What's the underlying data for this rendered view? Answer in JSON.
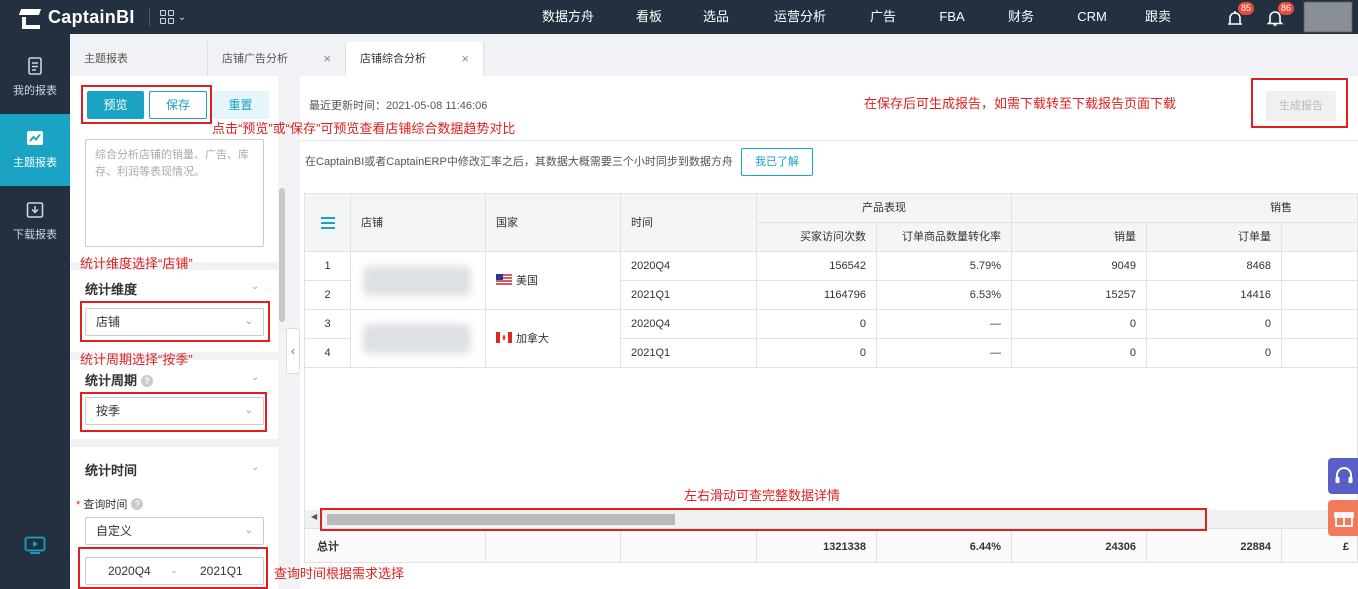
{
  "brand": {
    "name": "CaptainBI"
  },
  "nav": {
    "items": [
      "数据方舟",
      "看板",
      "选品",
      "运营分析",
      "广告",
      "FBA",
      "财务",
      "CRM",
      "跟卖"
    ],
    "notif1_badge": "85",
    "notif2_badge": "86"
  },
  "sidebar": {
    "items": [
      {
        "label": "我的报表",
        "icon": "report-icon"
      },
      {
        "label": "主题报表",
        "icon": "chart-icon"
      },
      {
        "label": "下载报表",
        "icon": "download-icon"
      }
    ]
  },
  "tabs": [
    {
      "label": "主题报表",
      "closable": false
    },
    {
      "label": "店铺广告分析",
      "closable": true
    },
    {
      "label": "店铺综合分析",
      "closable": true
    }
  ],
  "filter": {
    "preview_label": "预览",
    "save_label": "保存",
    "reset_label": "重置",
    "description": "综合分析店铺的销量、广告、库存、利润等表现情况。",
    "dimension": {
      "title": "统计维度",
      "value": "店铺"
    },
    "period": {
      "title": "统计周期",
      "value": "按季"
    },
    "time": {
      "title": "统计时间",
      "query_label": "查询时间",
      "required_mark": "*",
      "mode": "自定义",
      "start": "2020Q4",
      "end": "2021Q1",
      "separator": "-"
    }
  },
  "main": {
    "last_updated": "最近更新时间：2021-05-08 11:46:06",
    "generate_label": "生成报告",
    "notice": "在CaptainBI或者CaptainERP中修改汇率之后，其数据大概需要三个小时同步到数据方舟",
    "ack_label": "我已了解"
  },
  "table": {
    "headers": {
      "shop": "店铺",
      "country": "国家",
      "time": "时间",
      "group_product": "产品表现",
      "group_sales": "销售",
      "visits": "买家访问次数",
      "conversion": "订单商品数量转化率",
      "sales_qty": "销量",
      "orders": "订单量"
    },
    "rows": [
      {
        "idx": "1",
        "time": "2020Q4",
        "visits": "156542",
        "conversion": "5.79%",
        "sales_qty": "9049",
        "orders": "8468"
      },
      {
        "idx": "2",
        "time": "2021Q1",
        "visits": "1164796",
        "conversion": "6.53%",
        "sales_qty": "15257",
        "orders": "14416"
      },
      {
        "idx": "3",
        "time": "2020Q4",
        "visits": "0",
        "conversion": "—",
        "sales_qty": "0",
        "orders": "0"
      },
      {
        "idx": "4",
        "time": "2021Q1",
        "visits": "0",
        "conversion": "—",
        "sales_qty": "0",
        "orders": "0"
      }
    ],
    "countries": [
      {
        "name": "美国",
        "flag": "us-flag-icon"
      },
      {
        "name": "加拿大",
        "flag": "ca-flag-icon"
      }
    ],
    "totals": {
      "label": "总计",
      "visits": "1321338",
      "conversion": "6.44%",
      "sales_qty": "24306",
      "orders": "22884",
      "overflow": "£"
    }
  },
  "annotations": {
    "preview_hint": "点击“预览”或“保存”可预览查看店铺综合数据趋势对比",
    "report_hint": "在保存后可生成报告，如需下载转至下载报告页面下载",
    "dimension_hint": "统计维度选择“店铺”",
    "period_hint": "统计周期选择“按季”",
    "scroll_hint": "左右滑动可查完整数据详情",
    "time_hint": "查询时间根据需求选择"
  },
  "colors": {
    "nav_bg": "#22303f",
    "accent": "#1aa3c3",
    "annotation": "#e02020",
    "badge": "#e94c3b"
  }
}
